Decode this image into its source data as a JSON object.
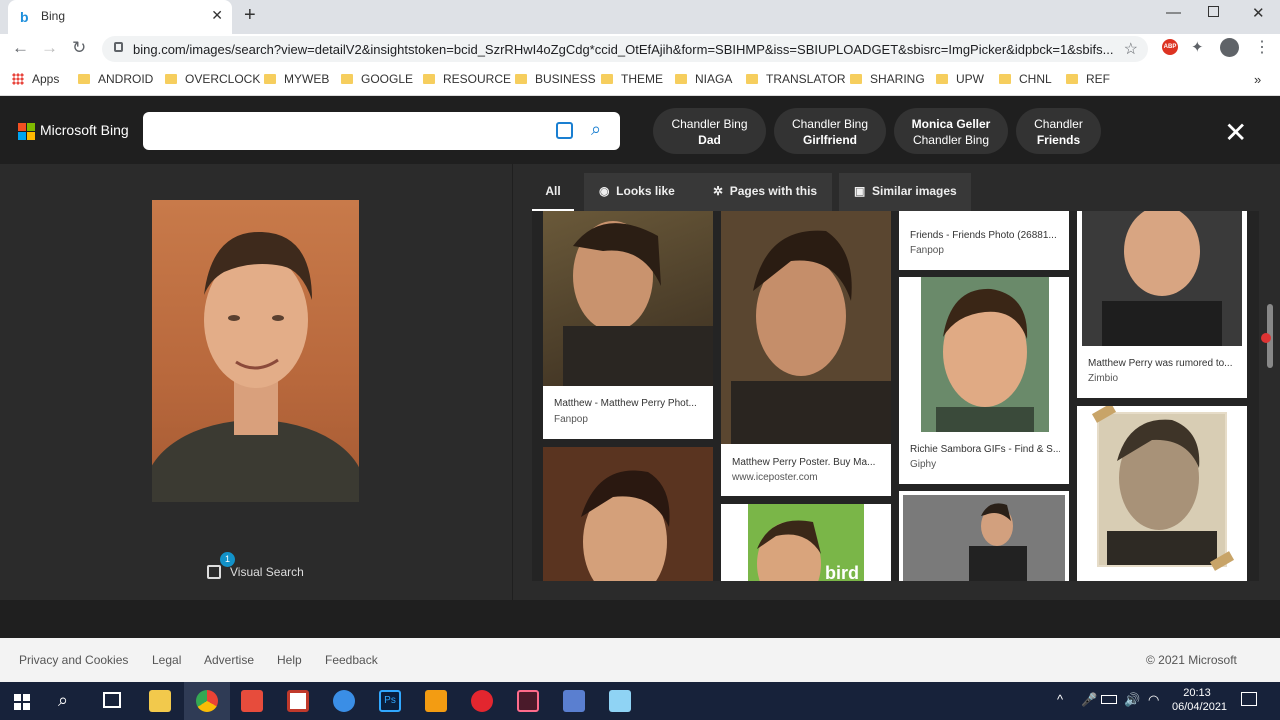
{
  "browser": {
    "tab_title": "Bing",
    "tab_favicon": "b",
    "url": "bing.com/images/search?view=detailV2&insightstoken=bcid_SzrRHwI4oZgCdg*ccid_OtEfAjih&form=SBIHMP&iss=SBIUPLOADGET&sbisrc=ImgPicker&idpbck=1&sbifs...",
    "bookmarks": [
      "Apps",
      "ANDROID",
      "OVERCLOCK",
      "MYWEB",
      "GOOGLE",
      "RESOURCE",
      "BUSINESS",
      "THEME",
      "NIAGA",
      "TRANSLATOR",
      "SHARING",
      "UPW",
      "CHNL",
      "REF"
    ],
    "ext_abp": "ABP"
  },
  "bing": {
    "logo_text": "Microsoft Bing",
    "search_value": "",
    "chips": [
      {
        "line1": "Chandler Bing",
        "line2": "Dad"
      },
      {
        "line1": "Chandler Bing",
        "line2": "Girlfriend"
      },
      {
        "line1": "Monica Geller",
        "line2": "Chandler Bing"
      },
      {
        "line1": "Chandler",
        "line2": "Friends"
      }
    ],
    "filters": [
      "All",
      "Looks like",
      "Pages with this",
      "Similar images"
    ],
    "visual_search_label": "Visual Search",
    "visual_search_badge": "1",
    "results": [
      {
        "caption": "Matthew - Matthew Perry Phot...",
        "source": "Fanpop"
      },
      {
        "caption": "Matthew Perry Poster. Buy Ma...",
        "source": "www.iceposter.com"
      },
      {
        "caption": "Friends - Friends Photo (26881...",
        "source": "Fanpop"
      },
      {
        "caption": "Richie Sambora GIFs - Find & S...",
        "source": "Giphy"
      },
      {
        "caption": "Matthew Perry was rumored to...",
        "source": "Zimbio"
      }
    ],
    "bird_text": "bird"
  },
  "footer": {
    "links": [
      "Privacy and Cookies",
      "Legal",
      "Advertise",
      "Help",
      "Feedback"
    ],
    "copyright": "© 2021 Microsoft"
  },
  "taskbar": {
    "time": "20:13",
    "date": "06/04/2021"
  }
}
